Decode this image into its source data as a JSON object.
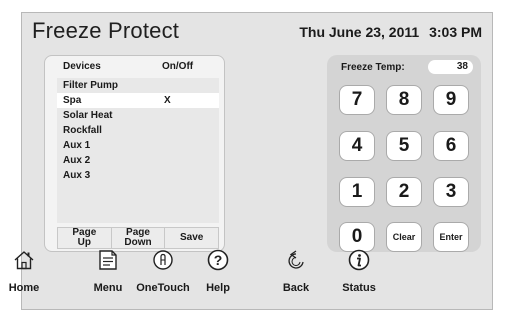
{
  "app": {
    "title": "Freeze Protect"
  },
  "datetime": {
    "date": "Thu June 23, 2011",
    "time": "3:03 PM"
  },
  "devices": {
    "header_devices": "Devices",
    "header_onoff": "On/Off",
    "items": [
      {
        "label": "Filter Pump",
        "state": ""
      },
      {
        "label": "Spa",
        "state": "X"
      },
      {
        "label": "Solar Heat",
        "state": ""
      },
      {
        "label": "Rockfall",
        "state": ""
      },
      {
        "label": "Aux 1",
        "state": ""
      },
      {
        "label": "Aux 2",
        "state": ""
      },
      {
        "label": "Aux 3",
        "state": ""
      }
    ],
    "selected_index": 1,
    "buttons": {
      "page_up": "Page Up",
      "page_down": "Page Down",
      "save": "Save"
    }
  },
  "freeze": {
    "label": "Freeze Temp:",
    "value": "38"
  },
  "keypad": {
    "keys": [
      "7",
      "8",
      "9",
      "4",
      "5",
      "6",
      "1",
      "2",
      "3",
      "0",
      "Clear",
      "Enter"
    ]
  },
  "nav": {
    "home": "Home",
    "menu": "Menu",
    "onetouch": "OneTouch",
    "help": "Help",
    "back": "Back",
    "status": "Status"
  },
  "icons": {
    "home": "home-icon",
    "menu": "menu-icon",
    "onetouch": "onetouch-icon",
    "help": "help-icon",
    "back": "back-icon",
    "status": "status-icon"
  },
  "colors": {
    "screen_bg": "#e4e4e4",
    "keypad_bg": "#d4d4d4",
    "key_bg": "#ffffff",
    "text": "#1a1a1a"
  }
}
